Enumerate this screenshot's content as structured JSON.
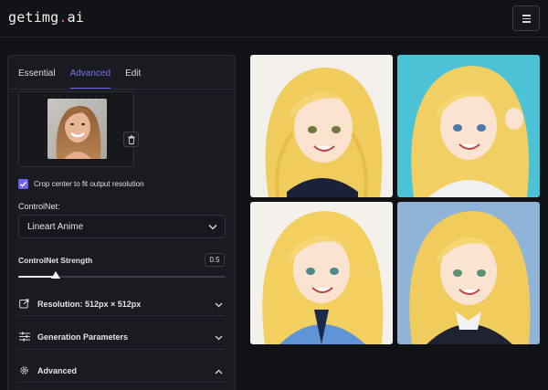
{
  "header": {
    "logo_main": "getimg",
    "logo_dot": ".",
    "logo_tld": "ai",
    "menu_icon": "hamburger-icon"
  },
  "tabs": [
    {
      "label": "Essential",
      "active": false
    },
    {
      "label": "Advanced",
      "active": true
    },
    {
      "label": "Edit",
      "active": false
    }
  ],
  "uploader": {
    "image": "reference-portrait",
    "delete_icon": "trash-icon"
  },
  "crop": {
    "checked": true,
    "label": "Crop center to fit output resolution"
  },
  "controlnet": {
    "label": "ControlNet:",
    "selected": "Lineart Anime"
  },
  "strength": {
    "label": "ControlNet Strength",
    "value": "0.5",
    "fraction": 0.18
  },
  "sections": [
    {
      "label": "Resolution: 512px × 512px",
      "icon": "resize-icon",
      "expanded": false
    },
    {
      "label": "Generation Parameters",
      "icon": "sliders-icon",
      "expanded": false
    },
    {
      "label": "Advanced",
      "icon": "gear-icon",
      "expanded": true
    }
  ],
  "gallery": {
    "images": [
      "anime-girl-dark-top",
      "anime-girl-cyan-bg",
      "anime-girl-blue-shirt",
      "anime-girl-blue-bg"
    ]
  },
  "colors": {
    "accent": "#6d63f2",
    "hair": "#f3d36b",
    "logo_dot": "#e85c6b"
  }
}
